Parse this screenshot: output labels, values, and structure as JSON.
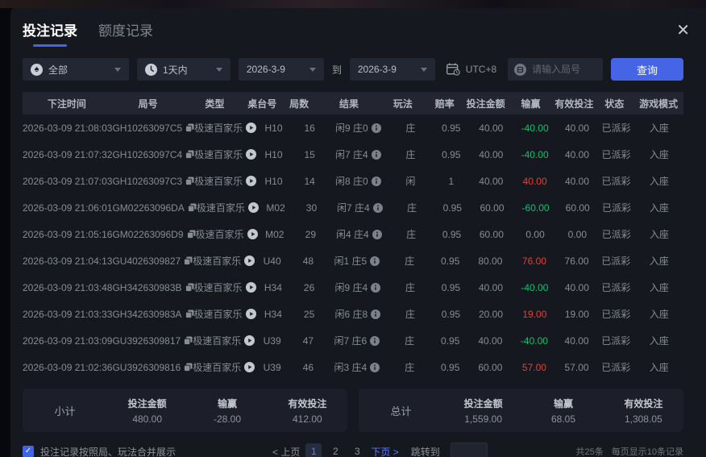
{
  "window": {
    "close_icon": "✕"
  },
  "tabs": [
    {
      "label": "投注记录",
      "active": true
    },
    {
      "label": "额度记录",
      "active": false
    }
  ],
  "filters": {
    "category_select": {
      "value": "全部",
      "icon": "spade-circle-icon"
    },
    "range_select": {
      "value": "1天内",
      "icon": "clock-icon"
    },
    "date_from": "2026-3-9",
    "to_label": "到",
    "date_to": "2026-3-9",
    "timezone": "UTC+8",
    "round_input_placeholder": "请输入局号",
    "search_button": "查询"
  },
  "table": {
    "columns": [
      "下注时间",
      "局号",
      "类型",
      "桌台号",
      "局数",
      "结果",
      "玩法",
      "赔率",
      "投注金额",
      "输赢",
      "有效投注",
      "状态",
      "游戏模式"
    ],
    "rows": [
      {
        "time": "2026-03-09 21:08:03",
        "round_id": "GH10263097C5",
        "game_type": "极速百家乐",
        "table_no": "H10",
        "round_no": "16",
        "result": "闲9 庄0",
        "play": "庄",
        "odds": "0.95",
        "bet_amount": "40.00",
        "win_loss": "-40.00",
        "valid_bet": "40.00",
        "status": "已派彩",
        "mode": "入座"
      },
      {
        "time": "2026-03-09 21:07:32",
        "round_id": "GH10263097C4",
        "game_type": "极速百家乐",
        "table_no": "H10",
        "round_no": "15",
        "result": "闲7 庄4",
        "play": "庄",
        "odds": "0.95",
        "bet_amount": "40.00",
        "win_loss": "-40.00",
        "valid_bet": "40.00",
        "status": "已派彩",
        "mode": "入座"
      },
      {
        "time": "2026-03-09 21:07:03",
        "round_id": "GH10263097C3",
        "game_type": "极速百家乐",
        "table_no": "H10",
        "round_no": "14",
        "result": "闲8 庄0",
        "play": "闲",
        "odds": "1",
        "bet_amount": "40.00",
        "win_loss": "40.00",
        "valid_bet": "40.00",
        "status": "已派彩",
        "mode": "入座"
      },
      {
        "time": "2026-03-09 21:06:01",
        "round_id": "GM02263096DA",
        "game_type": "极速百家乐",
        "table_no": "M02",
        "round_no": "30",
        "result": "闲7 庄4",
        "play": "庄",
        "odds": "0.95",
        "bet_amount": "60.00",
        "win_loss": "-60.00",
        "valid_bet": "60.00",
        "status": "已派彩",
        "mode": "入座"
      },
      {
        "time": "2026-03-09 21:05:16",
        "round_id": "GM02263096D9",
        "game_type": "极速百家乐",
        "table_no": "M02",
        "round_no": "29",
        "result": "闲4 庄4",
        "play": "庄",
        "odds": "0.95",
        "bet_amount": "60.00",
        "win_loss": "0.00",
        "valid_bet": "0.00",
        "status": "已派彩",
        "mode": "入座"
      },
      {
        "time": "2026-03-09 21:04:13",
        "round_id": "GU4026309827",
        "game_type": "极速百家乐",
        "table_no": "U40",
        "round_no": "48",
        "result": "闲1 庄5",
        "play": "庄",
        "odds": "0.95",
        "bet_amount": "80.00",
        "win_loss": "76.00",
        "valid_bet": "76.00",
        "status": "已派彩",
        "mode": "入座"
      },
      {
        "time": "2026-03-09 21:03:48",
        "round_id": "GH342630983B",
        "game_type": "极速百家乐",
        "table_no": "H34",
        "round_no": "26",
        "result": "闲9 庄4",
        "play": "庄",
        "odds": "0.95",
        "bet_amount": "40.00",
        "win_loss": "-40.00",
        "valid_bet": "40.00",
        "status": "已派彩",
        "mode": "入座"
      },
      {
        "time": "2026-03-09 21:03:33",
        "round_id": "GH342630983A",
        "game_type": "极速百家乐",
        "table_no": "H34",
        "round_no": "25",
        "result": "闲6 庄8",
        "play": "庄",
        "odds": "0.95",
        "bet_amount": "20.00",
        "win_loss": "19.00",
        "valid_bet": "19.00",
        "status": "已派彩",
        "mode": "入座"
      },
      {
        "time": "2026-03-09 21:03:09",
        "round_id": "GU3926309817",
        "game_type": "极速百家乐",
        "table_no": "U39",
        "round_no": "47",
        "result": "闲7 庄6",
        "play": "庄",
        "odds": "0.95",
        "bet_amount": "40.00",
        "win_loss": "-40.00",
        "valid_bet": "40.00",
        "status": "已派彩",
        "mode": "入座"
      },
      {
        "time": "2026-03-09 21:02:36",
        "round_id": "GU3926309816",
        "game_type": "极速百家乐",
        "table_no": "U39",
        "round_no": "46",
        "result": "闲3 庄4",
        "play": "庄",
        "odds": "0.95",
        "bet_amount": "60.00",
        "win_loss": "57.00",
        "valid_bet": "57.00",
        "status": "已派彩",
        "mode": "入座"
      }
    ]
  },
  "summary": {
    "subtotal": {
      "label": "小计",
      "items": [
        {
          "label": "投注金额",
          "value": "480.00"
        },
        {
          "label": "输赢",
          "value": "-28.00"
        },
        {
          "label": "有效投注",
          "value": "412.00"
        }
      ]
    },
    "total": {
      "label": "总计",
      "items": [
        {
          "label": "投注金额",
          "value": "1,559.00"
        },
        {
          "label": "输赢",
          "value": "68.05"
        },
        {
          "label": "有效投注",
          "value": "1,308.05"
        }
      ]
    }
  },
  "footer": {
    "merge_checkbox": {
      "checked": true,
      "label": "投注记录按照局、玩法合并展示"
    },
    "pagination": {
      "prev": "< 上页",
      "pages": [
        "1",
        "2",
        "3"
      ],
      "active": "1",
      "next": "下页 >",
      "jump_label": "跳转到",
      "jump_value": ""
    },
    "total_count": "共25条",
    "page_size": "每页显示10条记录"
  },
  "colors": {
    "accent": "#4565e6",
    "link_blue": "#5b7dff",
    "win_red": "#dc4337",
    "loss_green": "#10c070",
    "modal_bg": "#16181f",
    "header_bg": "#232631",
    "control_bg": "#232733"
  }
}
